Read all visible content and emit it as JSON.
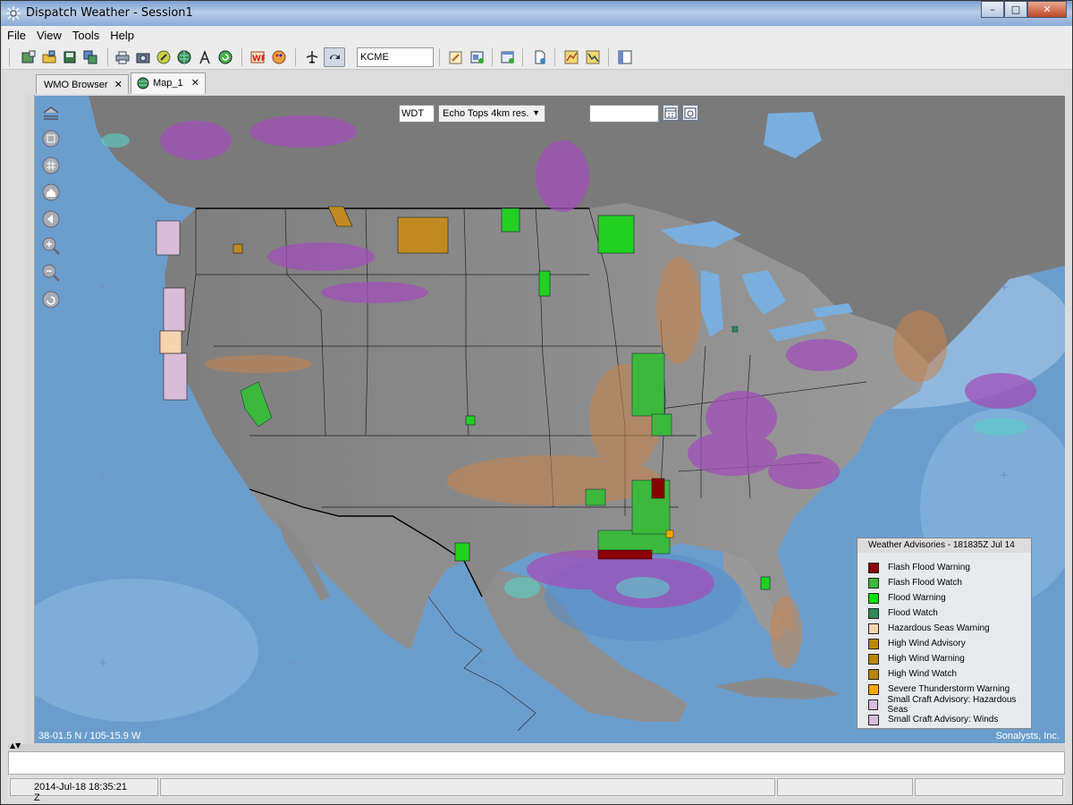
{
  "window": {
    "title": "Dispatch Weather - Session1",
    "controls": [
      "minimize",
      "maximize",
      "close"
    ]
  },
  "menu": [
    "File",
    "View",
    "Tools",
    "Help"
  ],
  "toolbar": {
    "station": "KCME",
    "icons": [
      "new-map-icon",
      "open-icon",
      "save-image-icon",
      "layers-icon",
      "print-icon",
      "camera-icon",
      "compass-icon",
      "globe-icon",
      "route-icon",
      "refresh-icon",
      "wp-icon",
      "palette-icon",
      "aircraft-icon",
      "loop-icon",
      "edit-note-icon",
      "add-layer-icon",
      "add-window-icon",
      "document-icon",
      "chart-a-icon",
      "chart-b-icon",
      "panel-icon"
    ]
  },
  "tabs": [
    {
      "label": "WMO Browser",
      "active": false
    },
    {
      "label": "Map_1",
      "active": true
    }
  ],
  "map": {
    "product_code": "WDT",
    "product": "Echo Tops 4km res.",
    "time_value": "",
    "coordinates": "38-01.5 N / 105-15.9 W",
    "credit": "Sonalysts, Inc.",
    "tools": [
      "home-layers-icon",
      "zoom-box-icon",
      "grid-icon",
      "home-icon",
      "back-icon",
      "zoom-in-icon",
      "zoom-out-icon",
      "rotate-icon"
    ]
  },
  "legend": {
    "title": "Weather Advisories - 181835Z Jul 14",
    "items": [
      {
        "label": "Flash Flood Warning",
        "color": "#8b0000"
      },
      {
        "label": "Flash Flood Watch",
        "color": "#3cb83c"
      },
      {
        "label": "Flood Warning",
        "color": "#00e000"
      },
      {
        "label": "Flood Watch",
        "color": "#2e8b57"
      },
      {
        "label": "Hazardous Seas Warning",
        "color": "#f5d4b0"
      },
      {
        "label": "High Wind Advisory",
        "color": "#b8860b"
      },
      {
        "label": "High Wind Warning",
        "color": "#b8860b"
      },
      {
        "label": "High Wind Watch",
        "color": "#b8860b"
      },
      {
        "label": "Severe Thunderstorm Warning",
        "color": "#ffa500"
      },
      {
        "label": "Small Craft Advisory: Hazardous Seas",
        "color": "#d8bcd8"
      },
      {
        "label": "Small Craft Advisory: Winds",
        "color": "#d8bcd8"
      }
    ]
  },
  "status": {
    "datetime": "2014-Jul-18 18:35:21 Z"
  }
}
